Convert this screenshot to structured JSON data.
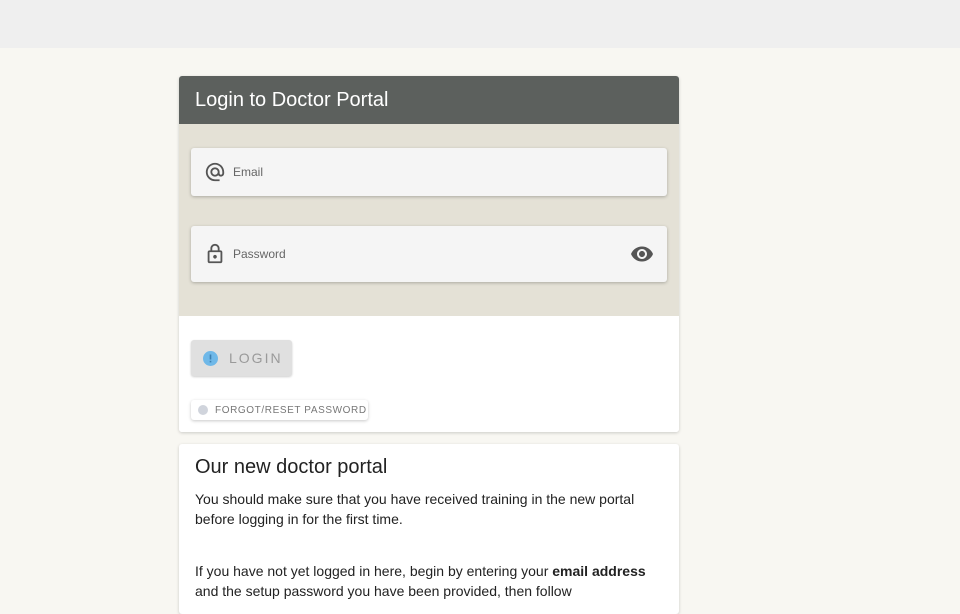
{
  "login": {
    "title": "Login to Doctor Portal",
    "email_placeholder": "Email",
    "password_placeholder": "Password",
    "login_label": "LOGIN",
    "forgot_label": "FORGOT/RESET PASSWORD"
  },
  "info": {
    "heading": "Our new doctor portal",
    "para1": "You should make sure that you have received training in the new portal before logging in for the first time.",
    "para2_start": "If you have not yet logged in here, begin by entering your ",
    "para2_bold": "email address",
    "para2_end": " and the setup password you have been provided, then follow"
  },
  "icons": {
    "email": "at-sign-icon",
    "password": "lock-icon",
    "toggle": "eye-icon"
  },
  "colors": {
    "header_bg": "#5c605d",
    "form_bg": "#e4e1d6",
    "page_bg": "#f8f7f2",
    "login_dot": "#6fb8e8"
  }
}
